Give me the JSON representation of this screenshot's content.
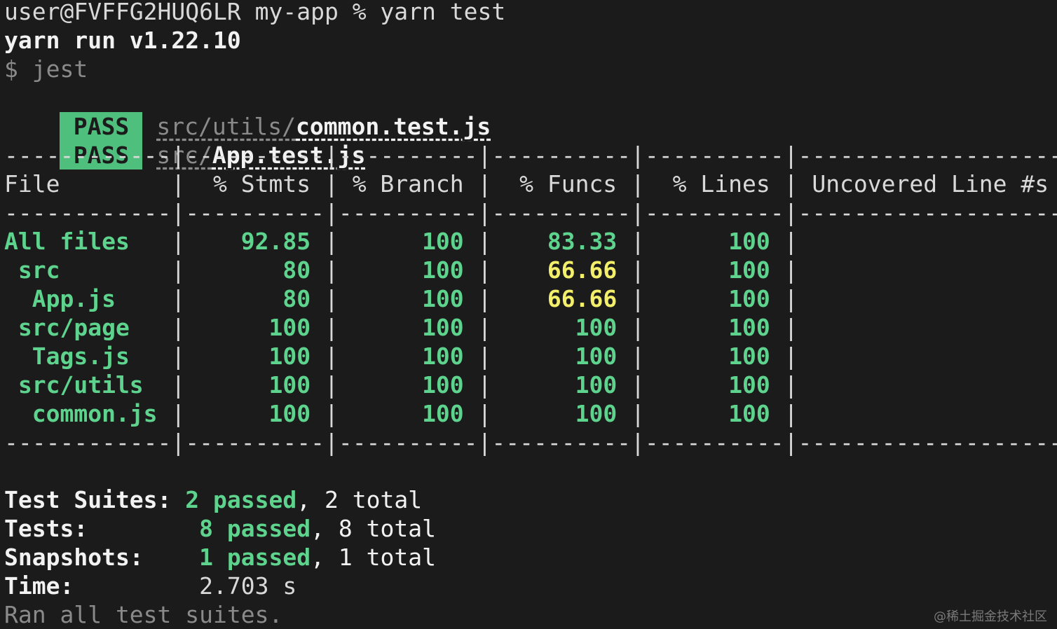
{
  "prompt": "user@FVFFG2HUQ6LR my-app % yarn test",
  "yarn_run": "yarn run v1.22.10",
  "cmd_echo": "$ jest",
  "results": [
    {
      "status": "PASS",
      "dir": "src/utils/",
      "file": "common.test.js"
    },
    {
      "status": "PASS",
      "dir": "src/",
      "file": "App.test.js"
    }
  ],
  "table": {
    "separator": "------------|----------|----------|----------|----------|-------------------",
    "headers": [
      "File",
      "% Stmts",
      "% Branch",
      "% Funcs",
      "% Lines",
      "Uncovered Line #s"
    ],
    "rows": [
      {
        "file": "All files",
        "stmts": "92.85",
        "branch": "100",
        "funcs": "83.33",
        "lines": "100",
        "uncovered": ""
      },
      {
        "file": " src",
        "stmts": "80",
        "branch": "100",
        "funcs": "66.66",
        "lines": "100",
        "uncovered": ""
      },
      {
        "file": "  App.js",
        "stmts": "80",
        "branch": "100",
        "funcs": "66.66",
        "lines": "100",
        "uncovered": ""
      },
      {
        "file": " src/page",
        "stmts": "100",
        "branch": "100",
        "funcs": "100",
        "lines": "100",
        "uncovered": ""
      },
      {
        "file": "  Tags.js",
        "stmts": "100",
        "branch": "100",
        "funcs": "100",
        "lines": "100",
        "uncovered": ""
      },
      {
        "file": " src/utils",
        "stmts": "100",
        "branch": "100",
        "funcs": "100",
        "lines": "100",
        "uncovered": ""
      },
      {
        "file": "  common.js",
        "stmts": "100",
        "branch": "100",
        "funcs": "100",
        "lines": "100",
        "uncovered": ""
      }
    ]
  },
  "summary": {
    "suites_label": "Test Suites:",
    "suites_passed": "2 passed",
    "suites_total": ", 2 total",
    "tests_label": "Tests:",
    "tests_passed": "8 passed",
    "tests_total": ", 8 total",
    "snap_label": "Snapshots:",
    "snap_passed": "1 passed",
    "snap_total": ", 1 total",
    "time_label": "Time:",
    "time_value": "2.703 s",
    "ran": "Ran all test suites."
  },
  "watermark": "@稀土掘金技术社区",
  "colors": {
    "pass_bg": "#4fbf7e",
    "green": "#5ed38d",
    "yellow": "#f3ef6a",
    "bg": "#1b1b1b"
  }
}
